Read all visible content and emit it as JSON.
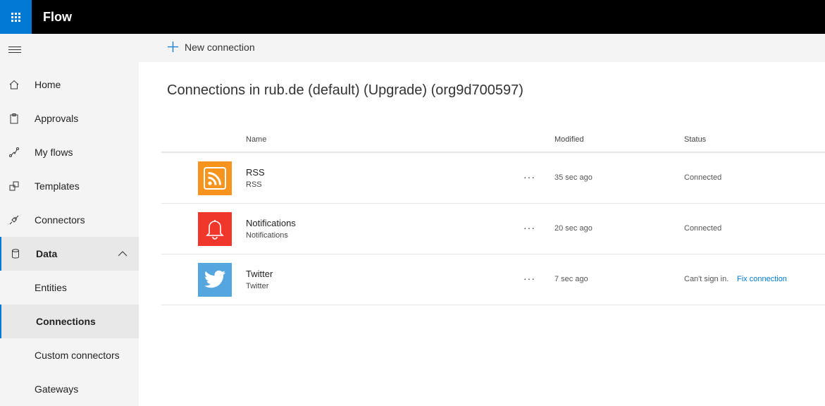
{
  "app": {
    "title": "Flow"
  },
  "sidebar": {
    "items": [
      {
        "label": "Home"
      },
      {
        "label": "Approvals"
      },
      {
        "label": "My flows"
      },
      {
        "label": "Templates"
      },
      {
        "label": "Connectors"
      },
      {
        "label": "Data"
      },
      {
        "label": "Entities"
      },
      {
        "label": "Connections"
      },
      {
        "label": "Custom connectors"
      },
      {
        "label": "Gateways"
      }
    ]
  },
  "toolbar": {
    "new_connection_label": "New connection"
  },
  "main": {
    "title": "Connections in rub.de (default) (Upgrade) (org9d700597)",
    "columns": {
      "name": "Name",
      "modified": "Modified",
      "status": "Status"
    },
    "rows": [
      {
        "name": "RSS",
        "subtitle": "RSS",
        "more": "···",
        "modified": "35 sec ago",
        "status": "Connected",
        "icon": "rss-icon",
        "color": "#f7941e"
      },
      {
        "name": "Notifications",
        "subtitle": "Notifications",
        "more": "···",
        "modified": "20 sec ago",
        "status": "Connected",
        "icon": "bell-icon",
        "color": "#f0372c"
      },
      {
        "name": "Twitter",
        "subtitle": "Twitter",
        "more": "···",
        "modified": "7 sec ago",
        "status": "Can't sign in.",
        "fix": "Fix connection",
        "icon": "twitter-bird-icon",
        "color": "#55a6de"
      }
    ]
  },
  "colors": {
    "accent": "#0078d4",
    "topbar": "#000000",
    "sidebar": "#f4f4f4"
  }
}
